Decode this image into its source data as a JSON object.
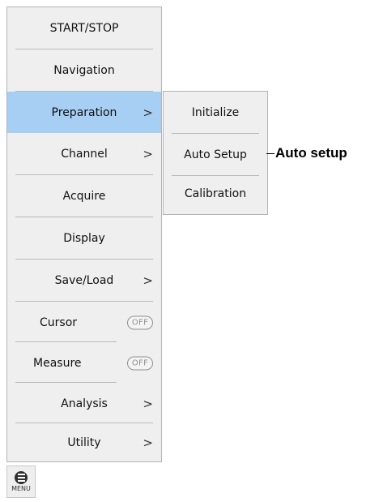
{
  "menu": {
    "items": [
      {
        "label": "START/STOP"
      },
      {
        "label": "Navigation"
      },
      {
        "label": "Preparation",
        "chevron": ">",
        "active": true
      },
      {
        "label": "Channel",
        "chevron": ">"
      },
      {
        "label": "Acquire"
      },
      {
        "label": "Display"
      },
      {
        "label": "Save/Load",
        "chevron": ">"
      },
      {
        "label": "Cursor",
        "toggle": "OFF"
      },
      {
        "label": "Measure",
        "toggle": "OFF"
      },
      {
        "label": "Analysis",
        "chevron": ">"
      },
      {
        "label": "Utility",
        "chevron": ">"
      }
    ]
  },
  "submenu": {
    "items": [
      {
        "label": "Initialize"
      },
      {
        "label": "Auto Setup"
      },
      {
        "label": "Calibration"
      }
    ]
  },
  "callout": {
    "text": "Auto setup"
  },
  "menu_button": {
    "label": "MENU",
    "icon": "menu-icon"
  },
  "colors": {
    "panel_bg": "#efefef",
    "active_bg": "#a6cff3",
    "separator": "#b9b9b9"
  }
}
